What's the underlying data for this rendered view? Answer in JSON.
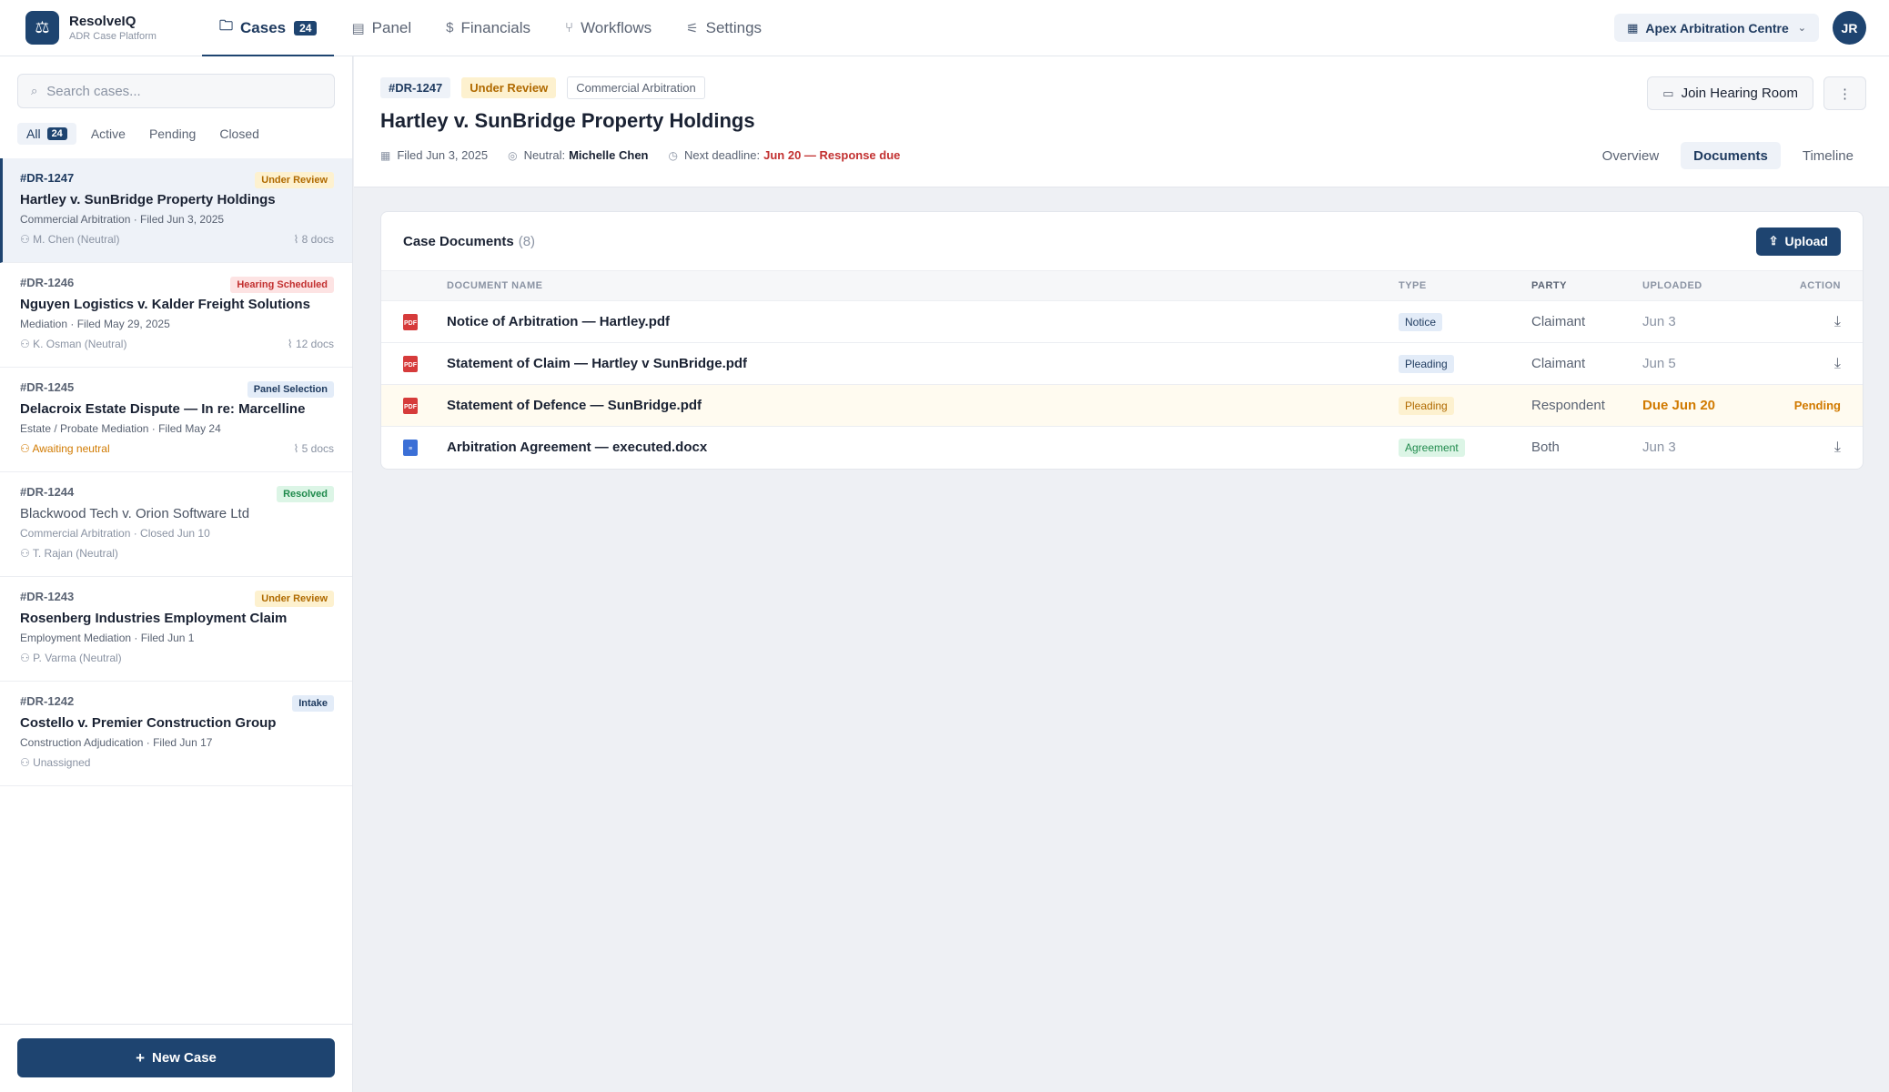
{
  "app": {
    "name": "ResolveIQ",
    "subtitle": "ADR Case Platform",
    "logo_icon": "⚖"
  },
  "nav": {
    "items": [
      {
        "label": "Cases",
        "icon": "folder-icon",
        "count": "24",
        "active": true
      },
      {
        "label": "Panel",
        "icon": "panel-icon"
      },
      {
        "label": "Financials",
        "icon": "dollar-icon"
      },
      {
        "label": "Workflows",
        "icon": "branch-icon"
      },
      {
        "label": "Settings",
        "icon": "sliders-icon"
      }
    ]
  },
  "org": {
    "name": "Apex Arbitration Centre",
    "icon": "building-icon"
  },
  "user": {
    "initials": "JR"
  },
  "sidebar": {
    "search_placeholder": "Search cases...",
    "filters": {
      "all": "All",
      "all_count": "24",
      "active": "Active",
      "pending": "Pending",
      "closed": "Closed"
    },
    "cases": [
      {
        "id": "#DR-1247",
        "status": "Under Review",
        "title": "Hartley v. SunBridge Property Holdings",
        "sub": "Commercial Arbitration · Filed Jun 3, 2025",
        "neutral": "M. Chen (Neutral)",
        "docs": "8 docs"
      },
      {
        "id": "#DR-1246",
        "status": "Hearing Scheduled",
        "title": "Nguyen Logistics v. Kalder Freight Solutions",
        "sub": "Mediation · Filed May 29, 2025",
        "neutral": "K. Osman (Neutral)",
        "docs": "12 docs"
      },
      {
        "id": "#DR-1245",
        "status": "Panel Selection",
        "title": "Delacroix Estate Dispute — In re: Marcelline",
        "sub": "Estate / Probate Mediation · Filed May 24",
        "neutral": "Awaiting neutral",
        "docs": "5 docs"
      },
      {
        "id": "#DR-1244",
        "status": "Resolved",
        "title": "Blackwood Tech v. Orion Software Ltd",
        "sub": "Commercial Arbitration · Closed Jun 10",
        "neutral": "T. Rajan (Neutral)",
        "docs": ""
      },
      {
        "id": "#DR-1243",
        "status": "Under Review",
        "title": "Rosenberg Industries Employment Claim",
        "sub": "Employment Mediation · Filed Jun 1",
        "neutral": "P. Varma (Neutral)",
        "docs": ""
      },
      {
        "id": "#DR-1242",
        "status": "Intake",
        "title": "Costello v. Premier Construction Group",
        "sub": "Construction Adjudication · Filed Jun 17",
        "neutral": "Unassigned",
        "docs": ""
      }
    ],
    "new_case_label": "New Case"
  },
  "case": {
    "id": "#DR-1247",
    "status": "Under Review",
    "type": "Commercial Arbitration",
    "title": "Hartley v. SunBridge Property Holdings",
    "filed": "Filed Jun 3, 2025",
    "neutral_label": "Neutral:",
    "neutral_name": "Michelle Chen",
    "deadline_label": "Next deadline:",
    "deadline_value": "Jun 20 — Response due",
    "join_label": "Join Hearing Room",
    "more_icon": "⋮",
    "tabs": [
      "Overview",
      "Documents",
      "Timeline"
    ],
    "active_tab": "Documents"
  },
  "documents": {
    "title": "Case Documents",
    "count": "(8)",
    "upload_label": "Upload",
    "columns": [
      "DOCUMENT NAME",
      "TYPE",
      "PARTY",
      "UPLOADED",
      "ACTION"
    ],
    "rows": [
      {
        "file_type": "PDF",
        "name": "Notice of Arbitration — Hartley.pdf",
        "type": "Notice",
        "party": "Claimant",
        "uploaded": "Jun 3",
        "action": "download"
      },
      {
        "file_type": "PDF",
        "name": "Statement of Claim — Hartley v SunBridge.pdf",
        "type": "Pleading",
        "party": "Claimant",
        "uploaded": "Jun 5",
        "action": "download"
      },
      {
        "file_type": "PDF",
        "name": "Statement of Defence — SunBridge.pdf",
        "type": "Pleading",
        "party": "Respondent",
        "uploaded": "Due Jun 20",
        "action": "Pending"
      },
      {
        "file_type": "DOCX",
        "name": "Arbitration Agreement — executed.docx",
        "type": "Agreement",
        "party": "Both",
        "uploaded": "Jun 3",
        "action": "download"
      }
    ]
  },
  "colors": {
    "accent": "#1e4470",
    "warning": "#d17a00",
    "danger": "#c23030",
    "success": "#1f8a4c"
  }
}
